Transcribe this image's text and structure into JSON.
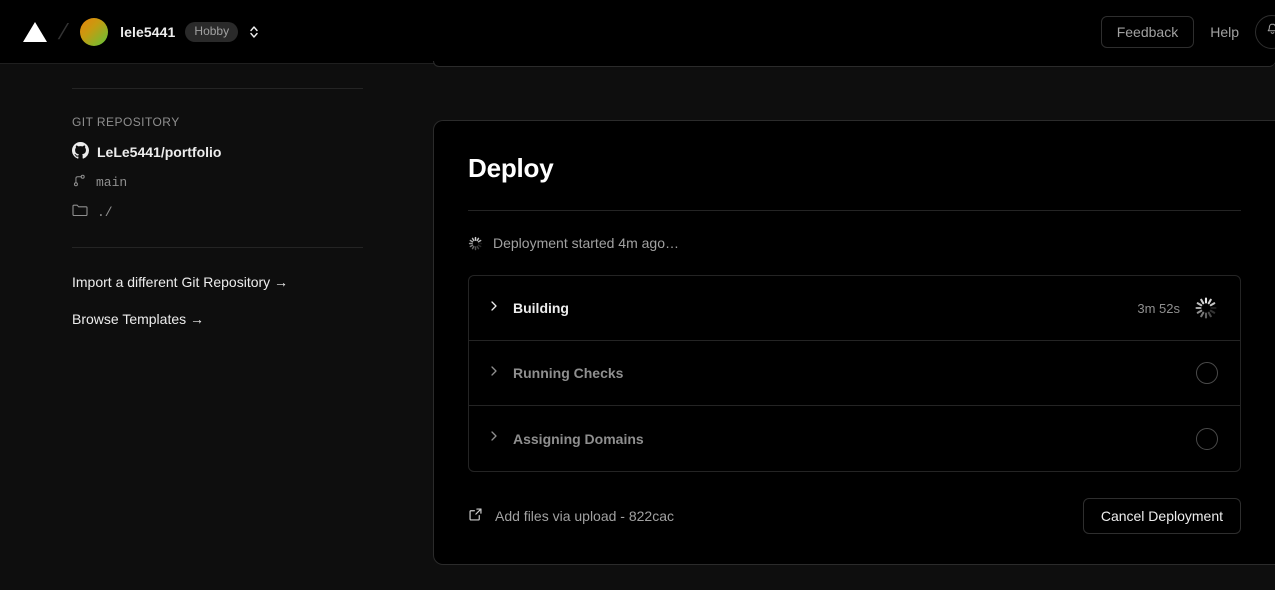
{
  "topbar": {
    "logo_icon": "vercel-triangle-icon",
    "separator": "/",
    "avatar_icon": "team-avatar",
    "team_name": "lele5441",
    "plan_badge": "Hobby",
    "selector_icon": "chevron-up-down-icon",
    "feedback_label": "Feedback",
    "help_label": "Help",
    "notifications_icon": "bell-icon"
  },
  "sidebar": {
    "section_title": "GIT REPOSITORY",
    "repo": {
      "icon": "github-icon",
      "name": "LeLe5441/portfolio"
    },
    "branch": {
      "icon": "git-branch-icon",
      "name": "main"
    },
    "directory": {
      "icon": "folder-icon",
      "name": "./"
    },
    "links": [
      {
        "label": "Import a different Git Repository →"
      },
      {
        "label": "Browse Templates →"
      }
    ]
  },
  "deploy_card": {
    "title": "Deploy",
    "status_icon": "loading-spinner-icon",
    "status_text": "Deployment started 4m ago…",
    "steps": [
      {
        "chevron_icon": "chevron-right-icon",
        "label": "Building",
        "time": "3m 52s",
        "state": "active",
        "state_icon": "loading-spinner-icon"
      },
      {
        "chevron_icon": "chevron-right-icon",
        "label": "Running Checks",
        "time": "",
        "state": "pending",
        "state_icon": "pending-circle-icon"
      },
      {
        "chevron_icon": "chevron-right-icon",
        "label": "Assigning Domains",
        "time": "",
        "state": "pending",
        "state_icon": "pending-circle-icon"
      }
    ],
    "commit": {
      "icon": "external-link-icon",
      "text": "Add files via upload - 822cac"
    },
    "cancel_label": "Cancel Deployment"
  },
  "colors": {
    "page_bg": "#0e0e0e",
    "card_bg": "#000000",
    "border": "#2b2b2b",
    "text_primary": "#ededed",
    "text_secondary": "#8f8f8f"
  }
}
